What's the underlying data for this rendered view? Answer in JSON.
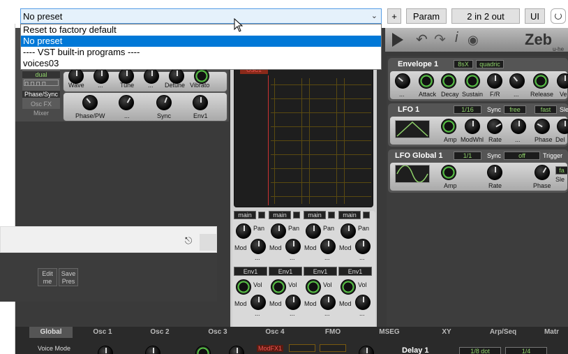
{
  "toolbar": {
    "preset_value": "No preset",
    "plus_label": "+",
    "param_label": "Param",
    "io_label": "2 in 2 out",
    "ui_label": "UI"
  },
  "preset_options": [
    "Reset to factory default",
    "No preset",
    "----  VST built-in programs  ----",
    "voices03"
  ],
  "brand": "Zeb",
  "brand_sub": "u-he",
  "osc": {
    "dual_label": "dual",
    "row1": [
      "Wave",
      "...",
      "Tune",
      "...",
      "Detune",
      "Vibrato"
    ],
    "side_tabs": [
      "Phase/Sync",
      "Osc FX",
      "Mixer"
    ],
    "row2": [
      "Phase/PW",
      "...",
      "Sync",
      "Env1"
    ]
  },
  "grid_header": "OSC1",
  "mixer": {
    "main_labels": [
      "main",
      "main",
      "main",
      "main"
    ],
    "pan_label": "Pan",
    "mod_label": "Mod",
    "dots": "...",
    "env_labels": [
      "Env1",
      "Env1",
      "Env1",
      "Env1"
    ],
    "vol_label": "Vol"
  },
  "envelope1": {
    "title": "Envelope 1",
    "box1": "8sX",
    "box2": "quadric",
    "knobs": [
      "...",
      "Attack",
      "Decay",
      "Sustain",
      "F/R",
      "...",
      "Release",
      "Ve"
    ]
  },
  "lfo1": {
    "title": "LFO 1",
    "rate_box": "1/16",
    "sync_label": "Sync",
    "sync_value": "free",
    "speed_value": "fast",
    "sle_label": "Sle",
    "knobs": [
      "Amp",
      "ModWhl",
      "Rate",
      "...",
      "Phase",
      "Del"
    ]
  },
  "lfoglobal1": {
    "title": "LFO Global 1",
    "rate_box": "1/1",
    "sync_label": "Sync",
    "sync_value": "off",
    "trigger_label": "Trigger",
    "trigger_value": "fa",
    "sle_label": "Sle",
    "knobs": [
      "Amp",
      "Rate",
      "Phase"
    ]
  },
  "overlay": {
    "edit_me": "Edit me",
    "save_pres": "Save Pres"
  },
  "tabs": [
    "Global",
    "Osc 1",
    "Osc 2",
    "Osc 3",
    "Osc 4",
    "FMO",
    "MSEG",
    "XY",
    "Arp/Seq",
    "Matr"
  ],
  "active_tab": "Global",
  "bottom": {
    "voice_mode": "Voice Mode",
    "modfx": "ModFX1",
    "delay": "Delay 1",
    "delay_box1": "1/8 dot",
    "delay_box2": "1/4"
  },
  "colors": {
    "accent_green": "#6fd85a",
    "select_blue": "#0078d7",
    "panel_dark": "#3a3a3a"
  }
}
